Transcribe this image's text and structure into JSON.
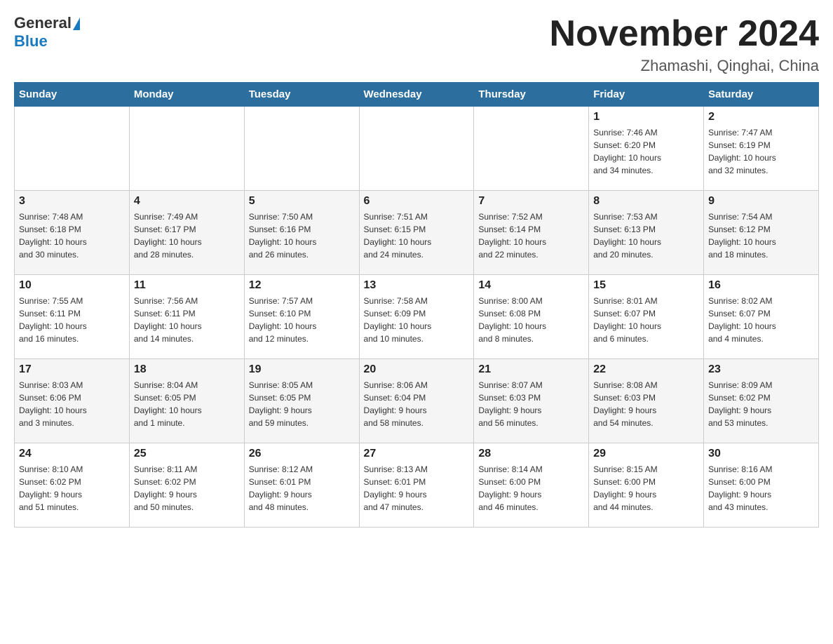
{
  "header": {
    "logo_general": "General",
    "logo_blue": "Blue",
    "month_title": "November 2024",
    "location": "Zhamashi, Qinghai, China"
  },
  "weekdays": [
    "Sunday",
    "Monday",
    "Tuesday",
    "Wednesday",
    "Thursday",
    "Friday",
    "Saturday"
  ],
  "weeks": [
    [
      {
        "day": "",
        "info": ""
      },
      {
        "day": "",
        "info": ""
      },
      {
        "day": "",
        "info": ""
      },
      {
        "day": "",
        "info": ""
      },
      {
        "day": "",
        "info": ""
      },
      {
        "day": "1",
        "info": "Sunrise: 7:46 AM\nSunset: 6:20 PM\nDaylight: 10 hours\nand 34 minutes."
      },
      {
        "day": "2",
        "info": "Sunrise: 7:47 AM\nSunset: 6:19 PM\nDaylight: 10 hours\nand 32 minutes."
      }
    ],
    [
      {
        "day": "3",
        "info": "Sunrise: 7:48 AM\nSunset: 6:18 PM\nDaylight: 10 hours\nand 30 minutes."
      },
      {
        "day": "4",
        "info": "Sunrise: 7:49 AM\nSunset: 6:17 PM\nDaylight: 10 hours\nand 28 minutes."
      },
      {
        "day": "5",
        "info": "Sunrise: 7:50 AM\nSunset: 6:16 PM\nDaylight: 10 hours\nand 26 minutes."
      },
      {
        "day": "6",
        "info": "Sunrise: 7:51 AM\nSunset: 6:15 PM\nDaylight: 10 hours\nand 24 minutes."
      },
      {
        "day": "7",
        "info": "Sunrise: 7:52 AM\nSunset: 6:14 PM\nDaylight: 10 hours\nand 22 minutes."
      },
      {
        "day": "8",
        "info": "Sunrise: 7:53 AM\nSunset: 6:13 PM\nDaylight: 10 hours\nand 20 minutes."
      },
      {
        "day": "9",
        "info": "Sunrise: 7:54 AM\nSunset: 6:12 PM\nDaylight: 10 hours\nand 18 minutes."
      }
    ],
    [
      {
        "day": "10",
        "info": "Sunrise: 7:55 AM\nSunset: 6:11 PM\nDaylight: 10 hours\nand 16 minutes."
      },
      {
        "day": "11",
        "info": "Sunrise: 7:56 AM\nSunset: 6:11 PM\nDaylight: 10 hours\nand 14 minutes."
      },
      {
        "day": "12",
        "info": "Sunrise: 7:57 AM\nSunset: 6:10 PM\nDaylight: 10 hours\nand 12 minutes."
      },
      {
        "day": "13",
        "info": "Sunrise: 7:58 AM\nSunset: 6:09 PM\nDaylight: 10 hours\nand 10 minutes."
      },
      {
        "day": "14",
        "info": "Sunrise: 8:00 AM\nSunset: 6:08 PM\nDaylight: 10 hours\nand 8 minutes."
      },
      {
        "day": "15",
        "info": "Sunrise: 8:01 AM\nSunset: 6:07 PM\nDaylight: 10 hours\nand 6 minutes."
      },
      {
        "day": "16",
        "info": "Sunrise: 8:02 AM\nSunset: 6:07 PM\nDaylight: 10 hours\nand 4 minutes."
      }
    ],
    [
      {
        "day": "17",
        "info": "Sunrise: 8:03 AM\nSunset: 6:06 PM\nDaylight: 10 hours\nand 3 minutes."
      },
      {
        "day": "18",
        "info": "Sunrise: 8:04 AM\nSunset: 6:05 PM\nDaylight: 10 hours\nand 1 minute."
      },
      {
        "day": "19",
        "info": "Sunrise: 8:05 AM\nSunset: 6:05 PM\nDaylight: 9 hours\nand 59 minutes."
      },
      {
        "day": "20",
        "info": "Sunrise: 8:06 AM\nSunset: 6:04 PM\nDaylight: 9 hours\nand 58 minutes."
      },
      {
        "day": "21",
        "info": "Sunrise: 8:07 AM\nSunset: 6:03 PM\nDaylight: 9 hours\nand 56 minutes."
      },
      {
        "day": "22",
        "info": "Sunrise: 8:08 AM\nSunset: 6:03 PM\nDaylight: 9 hours\nand 54 minutes."
      },
      {
        "day": "23",
        "info": "Sunrise: 8:09 AM\nSunset: 6:02 PM\nDaylight: 9 hours\nand 53 minutes."
      }
    ],
    [
      {
        "day": "24",
        "info": "Sunrise: 8:10 AM\nSunset: 6:02 PM\nDaylight: 9 hours\nand 51 minutes."
      },
      {
        "day": "25",
        "info": "Sunrise: 8:11 AM\nSunset: 6:02 PM\nDaylight: 9 hours\nand 50 minutes."
      },
      {
        "day": "26",
        "info": "Sunrise: 8:12 AM\nSunset: 6:01 PM\nDaylight: 9 hours\nand 48 minutes."
      },
      {
        "day": "27",
        "info": "Sunrise: 8:13 AM\nSunset: 6:01 PM\nDaylight: 9 hours\nand 47 minutes."
      },
      {
        "day": "28",
        "info": "Sunrise: 8:14 AM\nSunset: 6:00 PM\nDaylight: 9 hours\nand 46 minutes."
      },
      {
        "day": "29",
        "info": "Sunrise: 8:15 AM\nSunset: 6:00 PM\nDaylight: 9 hours\nand 44 minutes."
      },
      {
        "day": "30",
        "info": "Sunrise: 8:16 AM\nSunset: 6:00 PM\nDaylight: 9 hours\nand 43 minutes."
      }
    ]
  ]
}
